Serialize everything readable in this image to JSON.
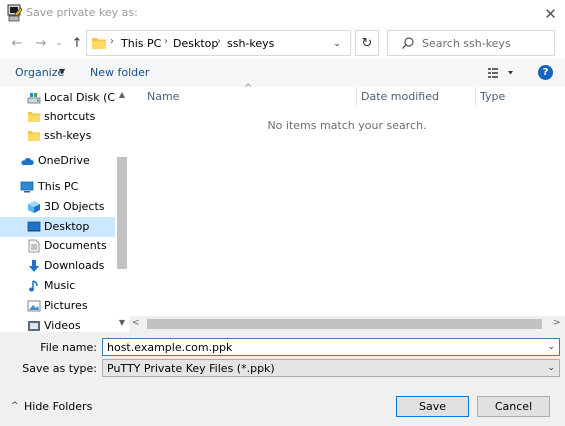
{
  "window": {
    "title": "Save private key as:",
    "close_glyph": "✕"
  },
  "nav": {
    "back_glyph": "←",
    "forward_glyph": "→",
    "recent_glyph": "⌄",
    "up_glyph": "↑",
    "breadcrumbs": [
      "This PC",
      "Desktop",
      "ssh-keys"
    ],
    "breadcrumb_separator": "›",
    "address_dropdown_glyph": "⌄",
    "refresh_glyph": "↻",
    "search_placeholder": "Search ssh-keys"
  },
  "toolbar": {
    "organize_label": "Organize",
    "organize_caret": "▼",
    "new_folder_label": "New folder",
    "help_label": "?"
  },
  "sidebar": {
    "items": [
      {
        "label": "Local Disk (C:)",
        "icon": "drive-icon"
      },
      {
        "label": "shortcuts",
        "icon": "folder-icon"
      },
      {
        "label": "ssh-keys",
        "icon": "folder-icon"
      },
      {
        "label": "OneDrive",
        "icon": "cloud-icon"
      },
      {
        "label": "This PC",
        "icon": "computer-icon"
      },
      {
        "label": "3D Objects",
        "icon": "cube-icon"
      },
      {
        "label": "Desktop",
        "icon": "desktop-icon",
        "selected": true
      },
      {
        "label": "Documents",
        "icon": "document-icon"
      },
      {
        "label": "Downloads",
        "icon": "download-icon"
      },
      {
        "label": "Music",
        "icon": "music-icon"
      },
      {
        "label": "Pictures",
        "icon": "picture-icon"
      },
      {
        "label": "Videos",
        "icon": "video-icon"
      }
    ],
    "scroll_up_glyph": "▲",
    "scroll_down_glyph": "▼"
  },
  "content": {
    "columns": [
      "Name",
      "Date modified",
      "Type"
    ],
    "sort_glyph": "^",
    "empty_message": "No items match your search.",
    "scroll_left_glyph": "<",
    "scroll_right_glyph": ">"
  },
  "form": {
    "file_name_label": "File name:",
    "file_name_value": "host.example.com.ppk",
    "save_type_label": "Save as type:",
    "save_type_value": "PuTTY Private Key Files (*.ppk)",
    "dropdown_glyph": "⌄"
  },
  "footer": {
    "hide_folders_label": "Hide Folders",
    "hide_caret": "^",
    "save_label": "Save",
    "cancel_label": "Cancel"
  },
  "colors": {
    "selection": "#cce8ff",
    "link": "#1a4f86",
    "accent": "#0078d7"
  }
}
